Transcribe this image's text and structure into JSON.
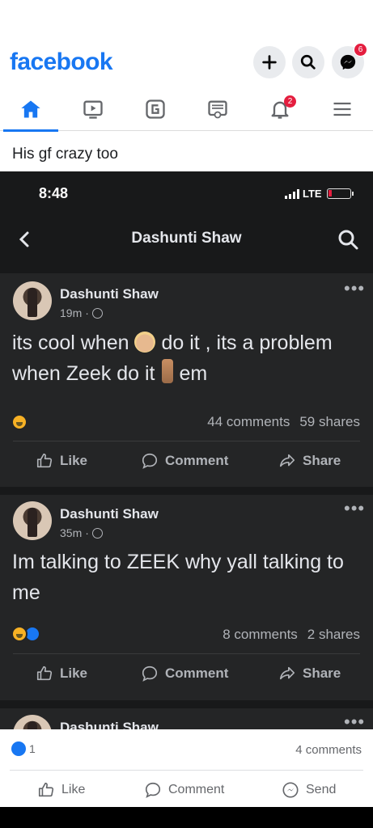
{
  "app": {
    "logo": "facebook",
    "accent": "#1877f2"
  },
  "header": {
    "buttons": [
      {
        "icon": "plus-icon"
      },
      {
        "icon": "search-icon"
      },
      {
        "icon": "messenger-icon",
        "badge": "6"
      }
    ]
  },
  "tabs": [
    {
      "name": "home",
      "icon": "home-icon",
      "active": true
    },
    {
      "name": "watch",
      "icon": "video-icon"
    },
    {
      "name": "gaming",
      "icon": "gaming-icon"
    },
    {
      "name": "marketplace",
      "icon": "marketplace-icon"
    },
    {
      "name": "notifications",
      "icon": "bell-icon",
      "badge": "2"
    },
    {
      "name": "menu",
      "icon": "hamburger-icon"
    }
  ],
  "post_caption": "His gf crazy too",
  "screenshot": {
    "status": {
      "time": "8:48",
      "network": "LTE"
    },
    "nav_title": "Dashunti Shaw",
    "posts": [
      {
        "author": "Dashunti Shaw",
        "time": "19m",
        "text_part1": "its cool when",
        "text_part2": "do it , its a problem when Zeek do it",
        "text_part3": "em",
        "comments": "44 comments",
        "shares": "59 shares",
        "actions": {
          "like": "Like",
          "comment": "Comment",
          "share": "Share"
        }
      },
      {
        "author": "Dashunti Shaw",
        "time": "35m",
        "text": "Im talking to ZEEK why yall talking to me",
        "comments": "8 comments",
        "shares": "2 shares",
        "actions": {
          "like": "Like",
          "comment": "Comment",
          "share": "Share"
        }
      },
      {
        "author": "Dashunti Shaw"
      }
    ]
  },
  "footer": {
    "like_count": "1",
    "comments_count": "4 comments",
    "actions": {
      "like": "Like",
      "comment": "Comment",
      "send": "Send"
    }
  }
}
